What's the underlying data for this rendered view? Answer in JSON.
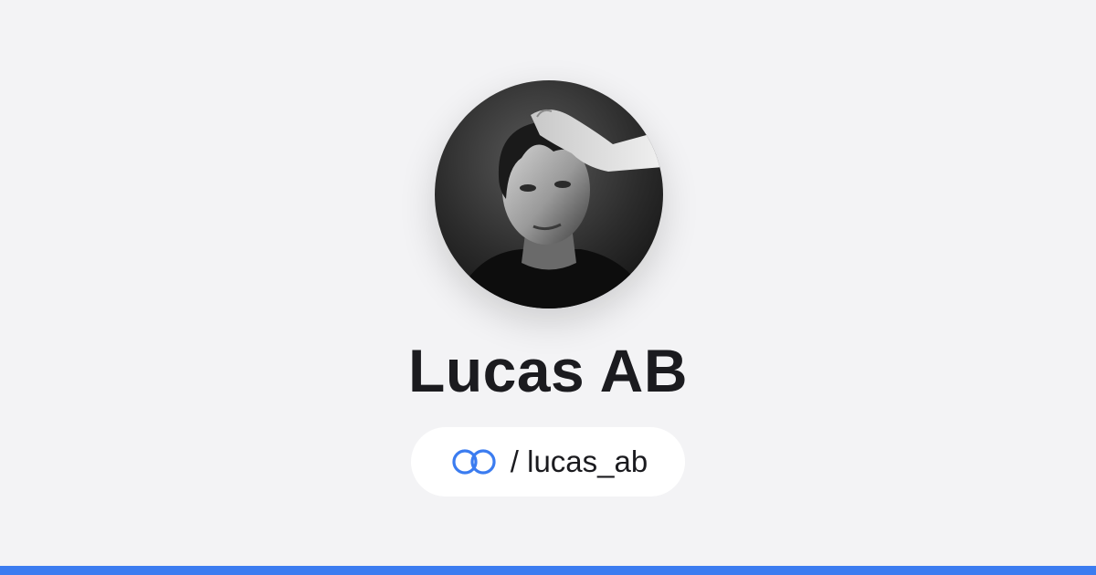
{
  "profile": {
    "name": "Lucas AB",
    "handle": "/ lucas_ab",
    "avatar_alt": "Lucas AB profile photo"
  },
  "icons": {
    "logo": "linked-rings-icon"
  },
  "colors": {
    "background": "#f3f3f5",
    "accent": "#3b7cf0",
    "text": "#1b1b1f",
    "pill": "#ffffff"
  }
}
